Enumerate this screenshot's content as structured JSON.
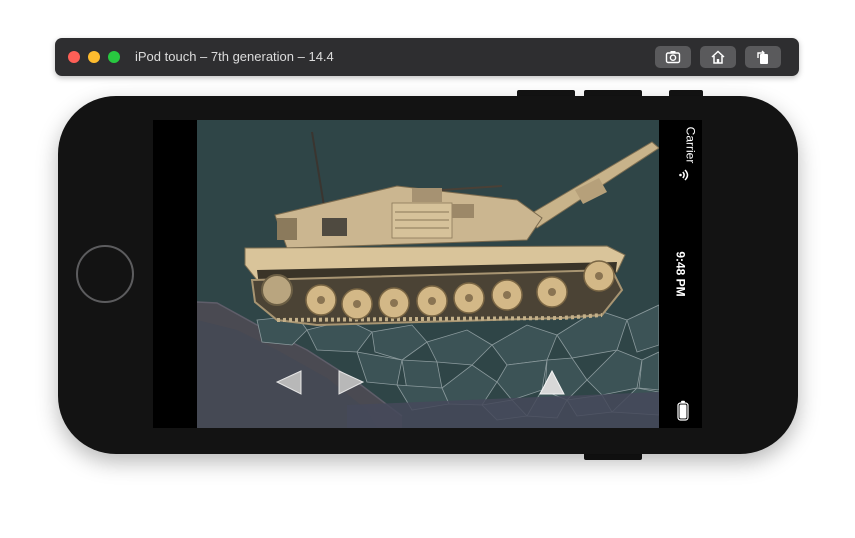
{
  "window": {
    "title": "iPod touch – 7th generation – 14.4",
    "toolbar_icons": [
      "screenshot-icon",
      "home-icon",
      "rotate-icon"
    ]
  },
  "status_bar": {
    "carrier": "Carrier",
    "time": "9:48 PM",
    "icons": [
      "wifi-icon",
      "battery-icon"
    ]
  },
  "game": {
    "controls": [
      "move-left-button",
      "move-right-button",
      "jump-button"
    ]
  },
  "colors": {
    "sky": "#2f4547",
    "device": "#131313",
    "titlebar": "#2e2e30"
  }
}
